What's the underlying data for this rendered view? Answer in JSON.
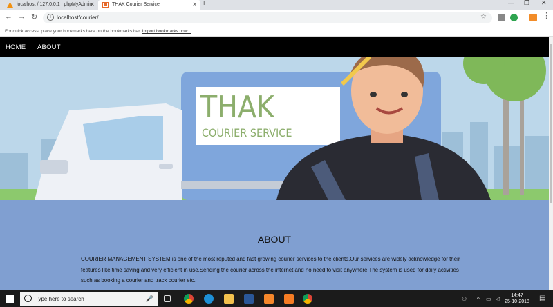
{
  "browser": {
    "tabs": [
      {
        "label": "localhost / 127.0.0.1 | phpMyAdmin"
      },
      {
        "label": "THAK Courier Service"
      }
    ],
    "address": "localhost/courier/",
    "bookmarks_message": "For quick access, place your bookmarks here on the bookmarks bar.",
    "bookmarks_link": "Import bookmarks now..."
  },
  "site": {
    "nav": [
      {
        "label": "HOME"
      },
      {
        "label": "ABOUT"
      }
    ],
    "hero": {
      "title": "THAK",
      "subtitle": "COURIER SERVICE"
    },
    "about": {
      "heading": "ABOUT",
      "text": "COURIER MANAGEMENT SYSTEM is one of the most reputed and fast growing courier services to the clients.Our services are widely acknowledge for their features like time saving and very efficient in use.Sending the courier across the internet and no need to visit anywhere.The system is used for daily activities such as booking a courier and track courier etc."
    }
  },
  "taskbar": {
    "search_placeholder": "Type here to search",
    "time": "14:47",
    "date": "25-10-2018"
  },
  "colors": {
    "about_bg": "#809fd1",
    "nav_bg": "#000000",
    "sky": "#bcd7ea",
    "sign_green": "#8cae6c",
    "truck_blue": "#7fa6dc"
  },
  "icons": [
    "back-arrow-icon",
    "forward-arrow-icon",
    "reload-icon",
    "info-icon",
    "star-icon",
    "windows-start-icon",
    "search-icon",
    "microphone-icon",
    "task-view-icon",
    "chrome-icon",
    "edge-icon",
    "file-explorer-icon",
    "word-icon",
    "sublime-icon",
    "xampp-icon",
    "notifications-icon"
  ]
}
